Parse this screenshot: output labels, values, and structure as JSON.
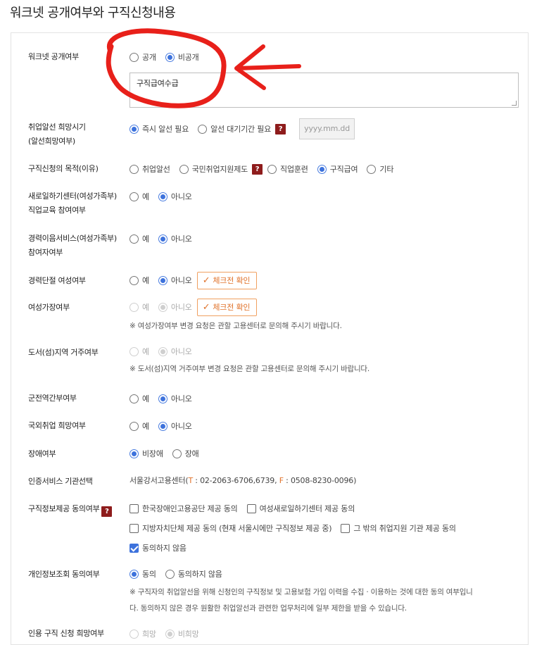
{
  "title": "워크넷 공개여부와 구직신청내용",
  "rows": {
    "worknet": {
      "label": "워크넷 공개여부",
      "opt1": "공개",
      "opt2": "비공개",
      "textarea": "구직급여수급"
    },
    "hope_time": {
      "label1": "취업알선 희망시기",
      "label2": "(알선희망여부)",
      "opt1": "즉시 알선 필요",
      "opt2": "알선 대기기간 필요",
      "placeholder": "yyyy.mm.dd"
    },
    "purpose": {
      "label": "구직신청의 목적(이유)",
      "opt1": "취업알선",
      "opt2": "국민취업지원제도",
      "opt3": "직업훈련",
      "opt4": "구직급여",
      "opt5": "기타"
    },
    "saeil": {
      "label1": "새로일하기센터(여성가족부)",
      "label2": "직업교육 참여여부",
      "yes": "예",
      "no": "아니오"
    },
    "career_service": {
      "label1": "경력이음서비스(여성가족부)",
      "label2": "참여자여부",
      "yes": "예",
      "no": "아니오"
    },
    "career_break": {
      "label": "경력단절 여성여부",
      "yes": "예",
      "no": "아니오",
      "button": "체크전 확인"
    },
    "female_head": {
      "label": "여성가장여부",
      "yes": "예",
      "no": "아니오",
      "button": "체크전 확인",
      "note": "※ 여성가장여부 변경 요청은 관할 고용센터로 문의해 주시기 바랍니다."
    },
    "island": {
      "label": "도서(섬)지역 거주여부",
      "yes": "예",
      "no": "아니오",
      "note": "※ 도서(섬)지역 거주여부 변경 요청은 관할 고용센터로 문의해 주시기 바랍니다."
    },
    "military": {
      "label": "군전역간부여부",
      "yes": "예",
      "no": "아니오"
    },
    "overseas": {
      "label": "국외취업 희망여부",
      "yes": "예",
      "no": "아니오"
    },
    "disability": {
      "label": "장애여부",
      "opt1": "비장애",
      "opt2": "장애"
    },
    "center": {
      "label": "인증서비스 기관선택",
      "name": "서울강서고용센터(",
      "t_key": "T",
      "t_val": " : 02-2063-6706,6739, ",
      "f_key": "F",
      "f_val": " : 0508-8230-0096)"
    },
    "consent": {
      "label": "구직정보제공 동의여부",
      "c1": "한국장애인고용공단 제공 동의",
      "c2": "여성새로일하기센터 제공 동의",
      "c3": "지방자치단체 제공 동의 (현재 서울시에만 구직정보 제공 중)",
      "c4": "그 밖의 취업지원 기관 제공 동의",
      "c5": "동의하지 않음"
    },
    "privacy": {
      "label": "개인정보조회 동의여부",
      "opt1": "동의",
      "opt2": "동의하지 않음",
      "note1": "※ 구직자의 취업알선을 위해 신청인의 구직정보 및 고용보험 가입 이력을 수집 · 이용하는 것에 대한 동의 여부입니",
      "note2": "다. 동의하지 않은 경우 원활한 취업알선과 관련한 업무처리에 일부 제한을 받을 수 있습니다."
    },
    "last": {
      "label": "인용 구직 신청 희망여부",
      "opt1": "희망",
      "opt2": "비희망"
    }
  },
  "selected": {
    "worknet": "비공개",
    "hope_time": "즉시 알선 필요",
    "purpose": "구직급여",
    "disability": "비장애",
    "privacy": "동의"
  },
  "colors": {
    "accent": "#3d72dc",
    "orange": "#e0722a",
    "help": "#8e1c1c",
    "annotation": "#e8201a"
  },
  "icons": {
    "help": "question-mark-icon",
    "check": "checkmark-icon"
  }
}
